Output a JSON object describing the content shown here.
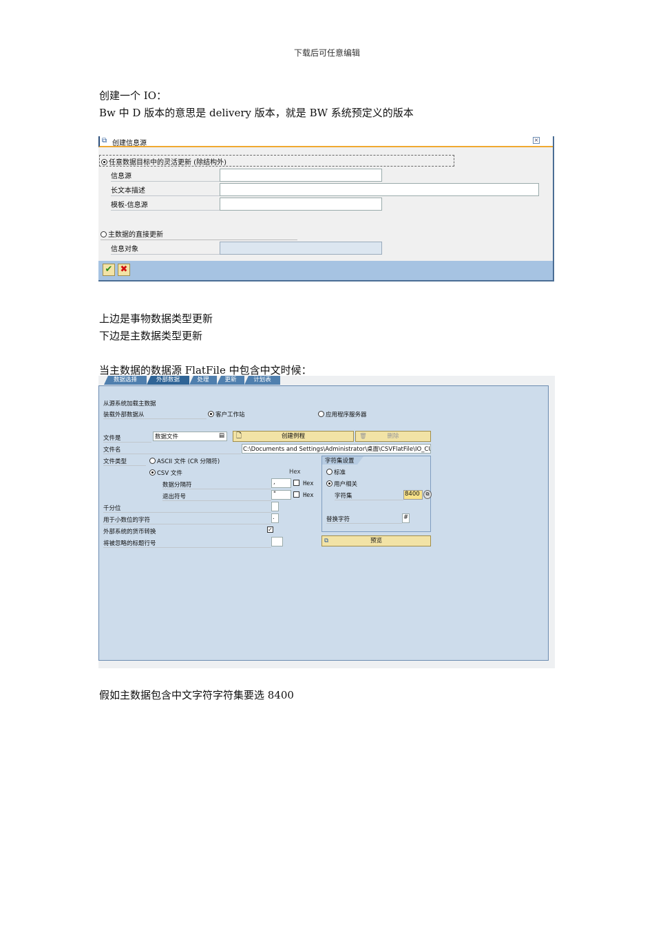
{
  "header": "下载后可任意编辑",
  "paragraphs": {
    "p1": "创建一个 IO：",
    "p2": "Bw 中 D 版本的意思是 delivery 版本，就是 BW 系统预定义的版本",
    "p3": "上边是事物数据类型更新",
    "p4": "下边是主数据类型更新",
    "p5": "当主数据的数据源 FlatFile 中包含中文时候：",
    "p6": "假如主数据包含中文字符字符集要选 8400"
  },
  "dialog1": {
    "title": "创建信息源",
    "option1": "任意数据目标中的灵活更新 (除结构外)",
    "infosource": "信息源",
    "longtext": "长文本描述",
    "template": "模板-信息源",
    "option2": "主数据的直接更新",
    "infoobject": "信息对象"
  },
  "screen2": {
    "tabs": [
      "数据选择",
      "外部数据",
      "处理",
      "更新",
      "计划表"
    ],
    "section": "从源系统加载主数据",
    "load_from": "装载外部数据从",
    "client": "客户工作站",
    "appserver": "应用程序服务器",
    "file_is": "文件是",
    "file_is_value": "数据文件",
    "create_routine": "创建例程",
    "delete": "删除",
    "filename": "文件名",
    "filename_value": "C:\\Documents and Settings\\Administrator\\桌面\\CSVFlatFile\\IO_CU",
    "filetype": "文件类型",
    "ascii": "ASCII 文件 (CR 分隔符)",
    "csv": "CSV 文件",
    "hex_header": "Hex",
    "separator": "数据分隔符",
    "separator_value": ",",
    "escape": "退出符号",
    "escape_value": "\"",
    "hex": "Hex",
    "thousands": "千分位",
    "decimal": "用于小数位的字符",
    "decimal_value": ".",
    "currency": "外部系统的货币转换",
    "header_rows": "将被忽略的标题行号",
    "charset_group": "字符集设置",
    "standard": "标准",
    "user": "用户相关",
    "charset": "字符集",
    "charset_value": "8400",
    "replace": "替换字符",
    "replace_value": "#",
    "preview": "预览"
  }
}
